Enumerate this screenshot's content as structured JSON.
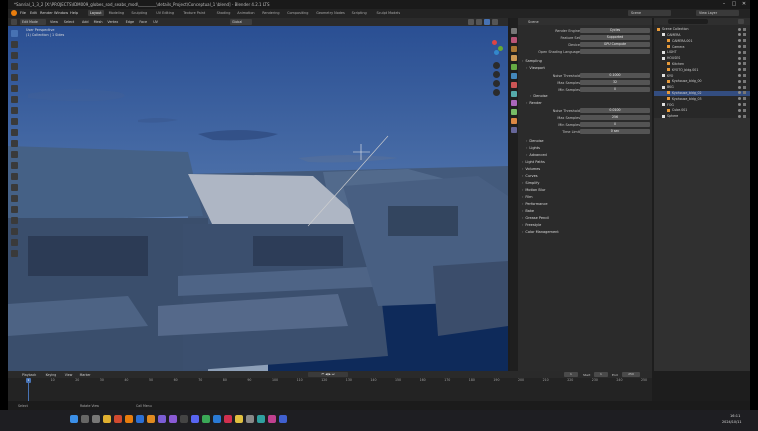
{
  "window": {
    "title": "*Sanrial_1_3_2 [X:\\PROJECTS\\IDM009_globes_sod_seabs_mod\\_________\\details_Project\\Conceptual_1 \\blend] - Blender 4.2.1 LTS"
  },
  "menubar": {
    "menus": [
      "File",
      "Edit",
      "Render",
      "Window",
      "Help"
    ],
    "workspaces": [
      "Layout",
      "Modeling",
      "Sculpting",
      "UV Editing",
      "Texture Paint",
      "Shading",
      "Animation",
      "Rendering",
      "Compositing",
      "Geometry Nodes",
      "Scripting",
      "Sculpt Models"
    ],
    "active_workspace": "Layout"
  },
  "viewport_header": {
    "mode": "Edit Mode",
    "menus": [
      "View",
      "Select",
      "Add",
      "Mesh",
      "Vertex",
      "Edge",
      "Face",
      "UV"
    ],
    "transform": "Global",
    "info_line1": "User Perspective",
    "info_line2": "(1) Collection | 1 Sides"
  },
  "properties": {
    "header": "Scene",
    "rows": [
      {
        "label": "Render Engine",
        "value": "Cycles"
      },
      {
        "label": "Feature Set",
        "value": "Supported"
      },
      {
        "label": "Device",
        "value": "GPU Compute"
      },
      {
        "label": "Open Shading Language",
        "value": ""
      }
    ],
    "sampling": "Sampling",
    "viewport": "Viewport",
    "viewport_rows": [
      {
        "label": "Noise Threshold",
        "value": "0.1000"
      },
      {
        "label": "Max Samples",
        "value": "32"
      },
      {
        "label": "Min Samples",
        "value": "0"
      }
    ],
    "denoise1": "Denoise",
    "render": "Render",
    "render_rows": [
      {
        "label": "Noise Threshold",
        "value": "0.0100"
      },
      {
        "label": "Max Samples",
        "value": "256"
      },
      {
        "label": "Min Samples",
        "value": "0"
      },
      {
        "label": "Time Limit",
        "value": "0 sec"
      }
    ],
    "sections": [
      "Denoise",
      "Lights",
      "Advanced",
      "Light Paths",
      "Volumes",
      "Curves",
      "Simplify",
      "Motion Blur",
      "Film",
      "Performance",
      "Bake",
      "Grease Pencil",
      "Freestyle",
      "Color Management"
    ]
  },
  "outliner": {
    "search_placeholder": "",
    "view_layer": "View Layer",
    "items": [
      {
        "label": "Scene Collection",
        "indent": 0
      },
      {
        "label": "CAMERA",
        "indent": 1
      },
      {
        "label": "CAMERA.001",
        "indent": 2
      },
      {
        "label": "Camera",
        "indent": 2
      },
      {
        "label": "LIGHT",
        "indent": 1
      },
      {
        "label": "HOUSES",
        "indent": 1
      },
      {
        "label": "Kitchen",
        "indent": 2
      },
      {
        "label": "KYOTO_bldg.001",
        "indent": 2
      },
      {
        "label": "KYO",
        "indent": 1
      },
      {
        "label": "Kyohouse_bldg_00",
        "indent": 2
      },
      {
        "label": "BKG",
        "indent": 1
      },
      {
        "label": "Kyohouse_bldg_02",
        "indent": 2,
        "selected": true
      },
      {
        "label": "Kyohouse_bldg_03",
        "indent": 2
      },
      {
        "label": "FOG",
        "indent": 1
      },
      {
        "label": "Cube.001",
        "indent": 2
      },
      {
        "label": "Sphere",
        "indent": 1
      }
    ]
  },
  "timeline": {
    "menus": [
      "Playback",
      "Keying",
      "View",
      "Marker"
    ],
    "current_frame": "1",
    "start_label": "Start",
    "start": "1",
    "end_label": "End",
    "end": "250",
    "ticks": [
      "0",
      "10",
      "20",
      "30",
      "40",
      "50",
      "60",
      "70",
      "80",
      "90",
      "100",
      "110",
      "120",
      "130",
      "140",
      "150",
      "160",
      "170",
      "180",
      "190",
      "200",
      "210",
      "220",
      "230",
      "240",
      "250"
    ]
  },
  "statusbar": {
    "left": "Select",
    "middle": "Rotate View",
    "right": "Call Menu"
  },
  "taskbar": {
    "clock_time": "16:11",
    "clock_date": "2024/10/11"
  }
}
